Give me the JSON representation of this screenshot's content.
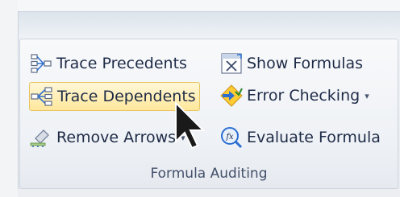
{
  "ribbon": {
    "group_label": "Formula Auditing",
    "commands": [
      {
        "label": "Trace Precedents",
        "icon": "trace-precedents-icon"
      },
      {
        "label": "Trace Dependents",
        "icon": "trace-dependents-icon"
      },
      {
        "label": "Remove Arrows",
        "icon": "remove-arrows-icon"
      },
      {
        "label": "Show Formulas",
        "icon": "show-formulas-icon"
      },
      {
        "label": "Error Checking",
        "icon": "error-checking-icon"
      },
      {
        "label": "Evaluate Formula",
        "icon": "evaluate-formula-icon"
      }
    ]
  },
  "colors": {
    "hover_fill": "#ffe79b",
    "hover_border": "#e8c560",
    "text": "#1e2b47"
  }
}
